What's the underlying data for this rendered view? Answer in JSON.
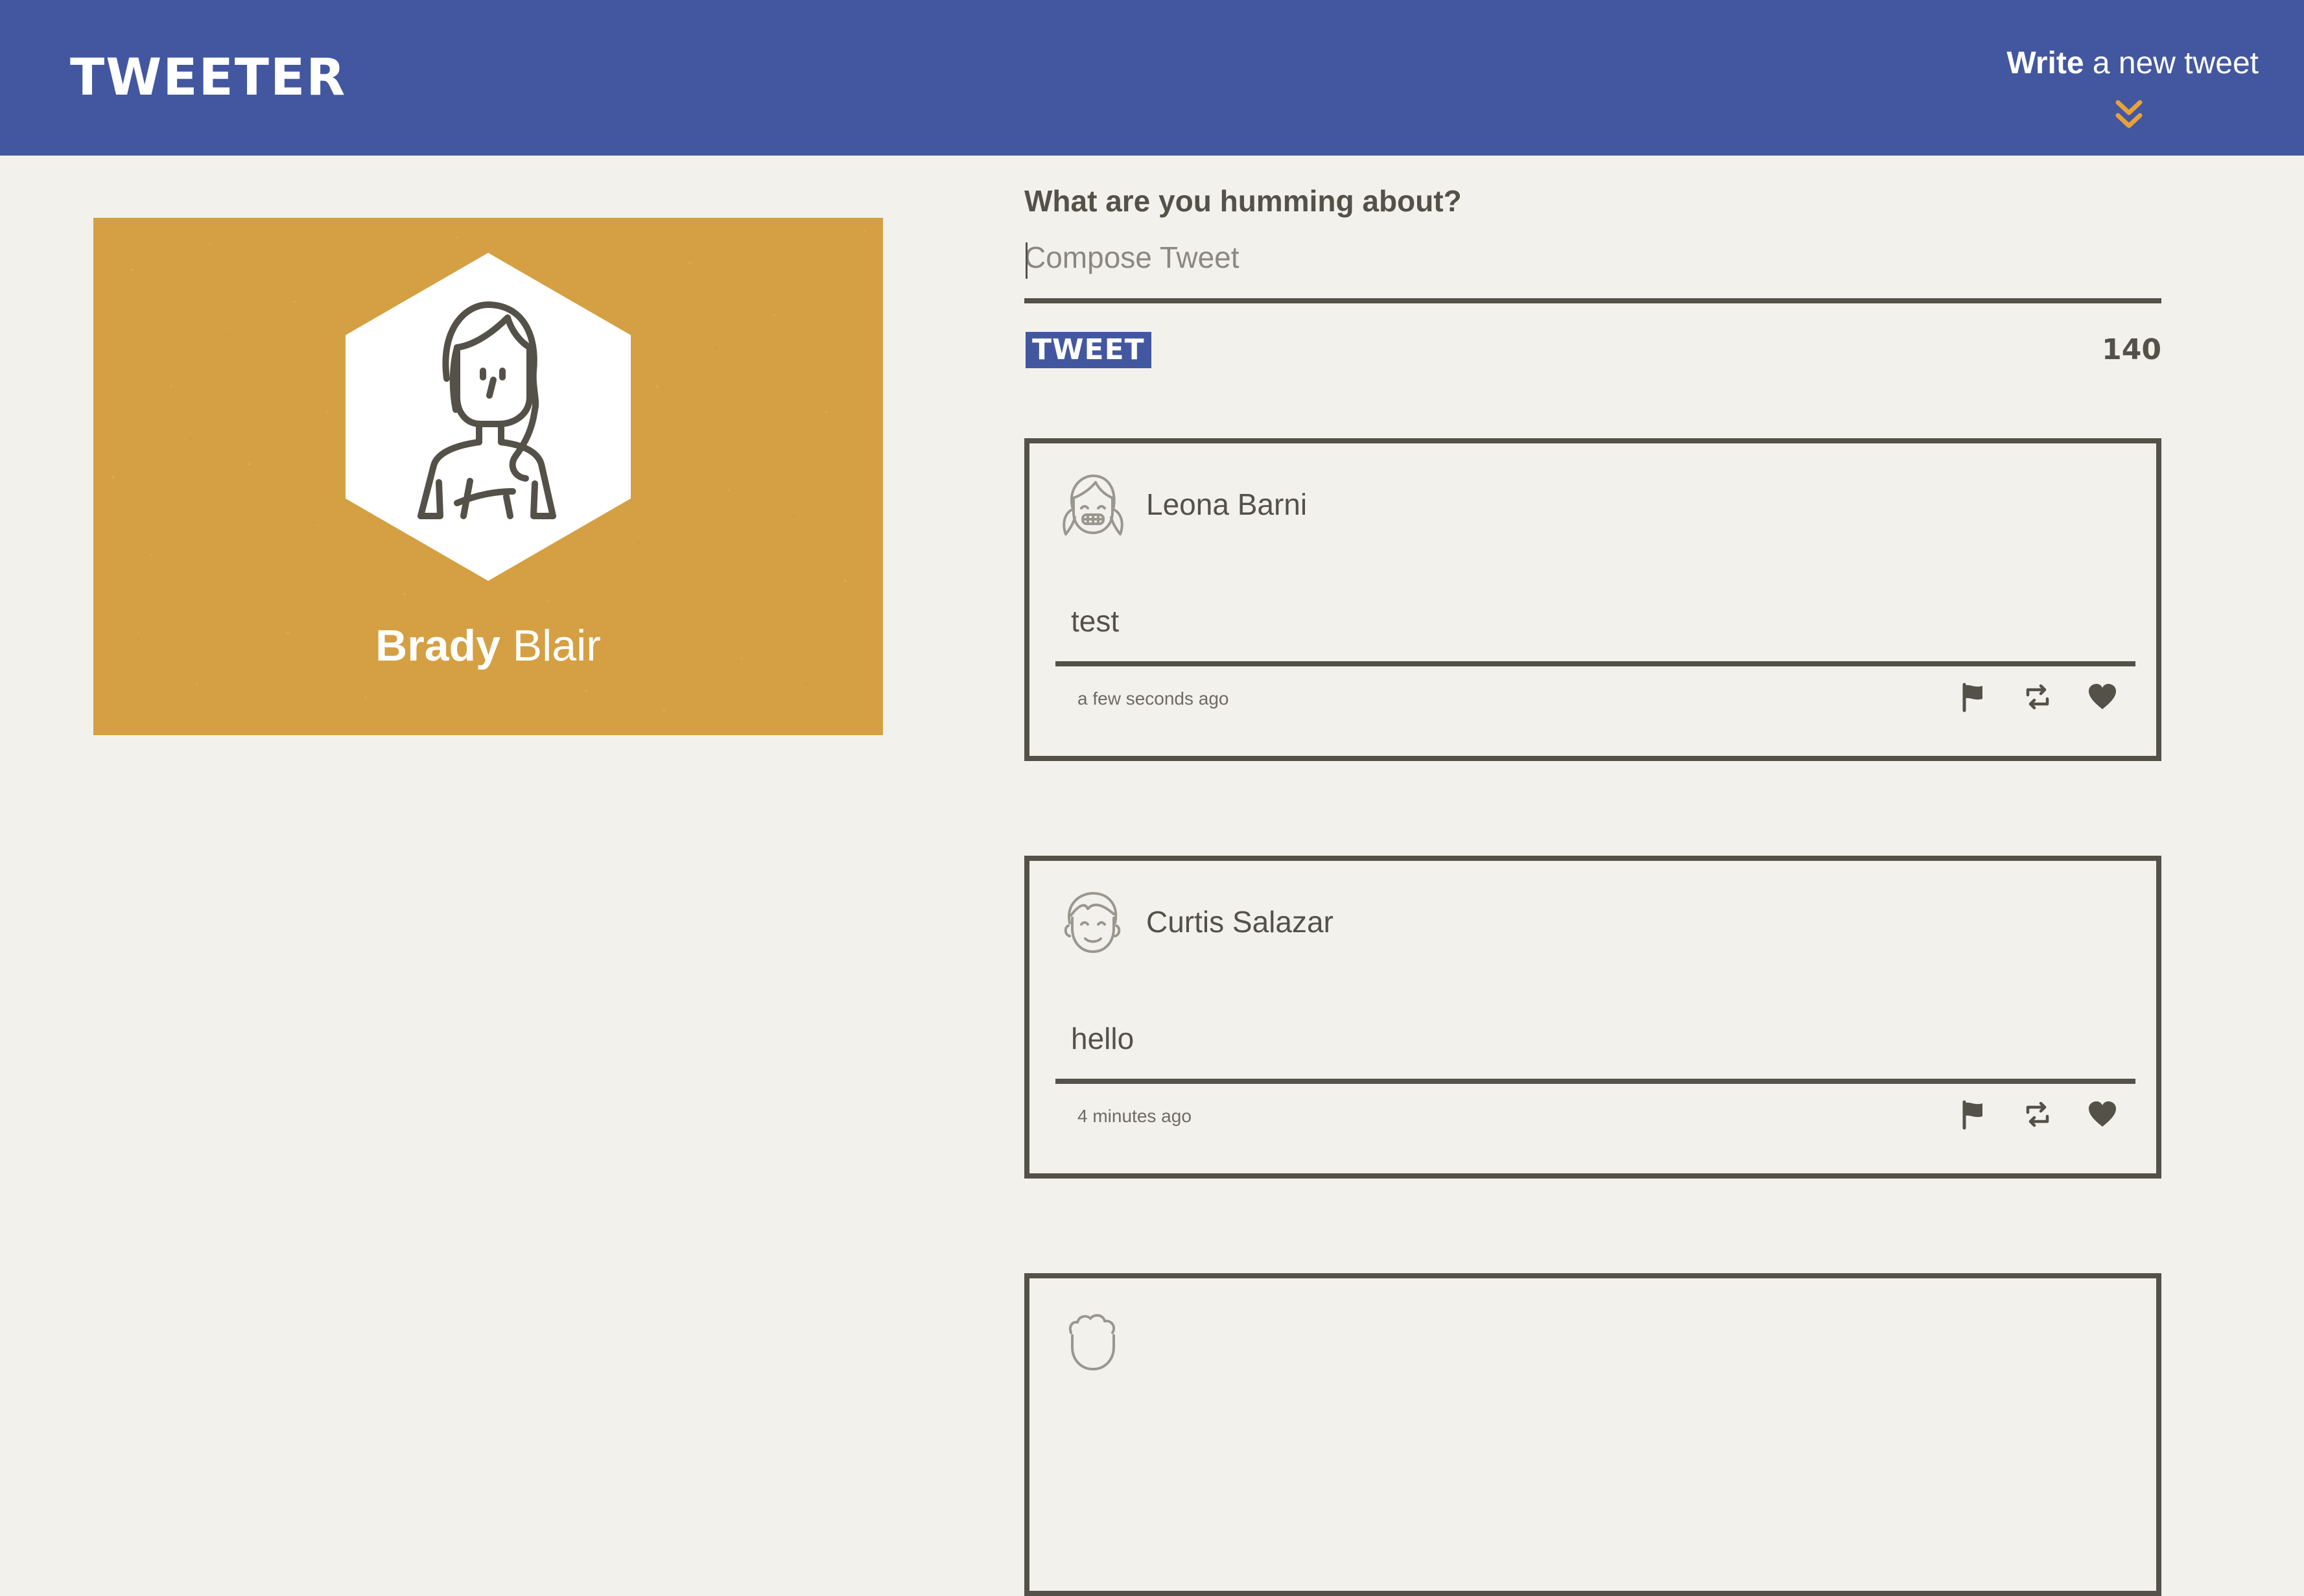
{
  "app": {
    "logo": "TWEETER",
    "compose_toggle": {
      "bold": "Write",
      "rest": " a new tweet",
      "icon": "double-chevron-down-icon"
    },
    "colors": {
      "header": "#4357a0",
      "profile_bg": "#d4a043",
      "page_bg": "#f2f1ec",
      "text": "#545149",
      "accent": "#e8a23a"
    }
  },
  "profile": {
    "first_name": "Brady",
    "last_name": " Blair",
    "avatar": "woman-avatar-icon"
  },
  "compose": {
    "label": "What are you humming about?",
    "placeholder": "Compose Tweet",
    "button": "TWEET",
    "counter": "140"
  },
  "tweets": [
    {
      "user": "Leona Barni",
      "avatar": "girl-pigtails-avatar-icon",
      "text": "test",
      "time": "a few seconds ago"
    },
    {
      "user": "Curtis Salazar",
      "avatar": "boy-avatar-icon",
      "text": "hello",
      "time": "4 minutes ago"
    },
    {
      "user": "",
      "avatar": "curly-hair-avatar-icon",
      "text": "",
      "time": ""
    }
  ]
}
